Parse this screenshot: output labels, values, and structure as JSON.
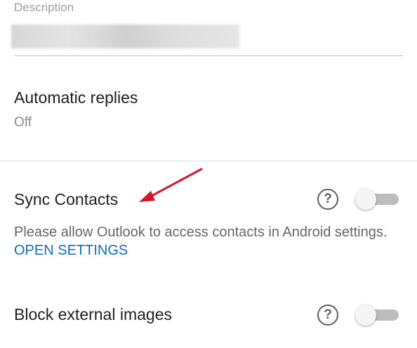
{
  "description_field": {
    "label": "Description",
    "value_redacted": true
  },
  "automatic_replies": {
    "title": "Automatic replies",
    "status": "Off"
  },
  "sync_contacts": {
    "title": "Sync Contacts",
    "help_icon": "question-circle-icon",
    "help_glyph": "?",
    "toggle_on": false,
    "description": "Please allow Outlook to access contacts in Android settings.",
    "link_label": "OPEN SETTINGS"
  },
  "block_external_images": {
    "title": "Block external images",
    "help_icon": "question-circle-icon",
    "help_glyph": "?",
    "toggle_on": false
  },
  "colors": {
    "link": "#0f6cbd",
    "annotation_arrow": "#d3152d",
    "toggle_track_off": "#bdbdbd",
    "toggle_thumb_off": "#f5f5f5"
  }
}
